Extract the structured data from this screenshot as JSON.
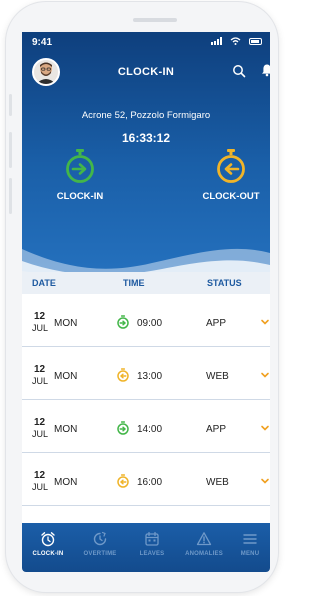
{
  "status_bar": {
    "time": "9:41"
  },
  "header": {
    "title": "CLOCK-IN"
  },
  "location": "Acrone 52, Pozzolo Formigaro",
  "current_time": "16:33:12",
  "actions": {
    "clock_in": {
      "label": "CLOCK-IN",
      "icon": "clock-in-icon",
      "color": "#43b649"
    },
    "clock_out": {
      "label": "CLOCK-OUT",
      "icon": "clock-out-icon",
      "color": "#f0b429"
    }
  },
  "table": {
    "headers": {
      "date": "DATE",
      "time": "TIME",
      "status": "STATUS"
    },
    "rows": [
      {
        "day": "12",
        "month": "JUL",
        "weekday": "MON",
        "type": "in",
        "time": "09:00",
        "status": "APP"
      },
      {
        "day": "12",
        "month": "JUL",
        "weekday": "MON",
        "type": "out",
        "time": "13:00",
        "status": "WEB"
      },
      {
        "day": "12",
        "month": "JUL",
        "weekday": "MON",
        "type": "in",
        "time": "14:00",
        "status": "APP"
      },
      {
        "day": "12",
        "month": "JUL",
        "weekday": "MON",
        "type": "out",
        "time": "16:00",
        "status": "WEB"
      }
    ]
  },
  "tabs": [
    {
      "label": "CLOCK-IN",
      "icon": "alarm-clock-icon",
      "active": true
    },
    {
      "label": "OVERTIME",
      "icon": "overtime-icon",
      "active": false
    },
    {
      "label": "LEAVES",
      "icon": "calendar-icon",
      "active": false
    },
    {
      "label": "ANOMALIES",
      "icon": "warning-icon",
      "active": false
    },
    {
      "label": "MENU",
      "icon": "menu-icon",
      "active": false
    }
  ],
  "colors": {
    "primary": "#1a5fa8",
    "header_dark": "#0e3f7d",
    "clock_in": "#43b649",
    "clock_out": "#f0b429",
    "chevron": "#f0a020"
  }
}
